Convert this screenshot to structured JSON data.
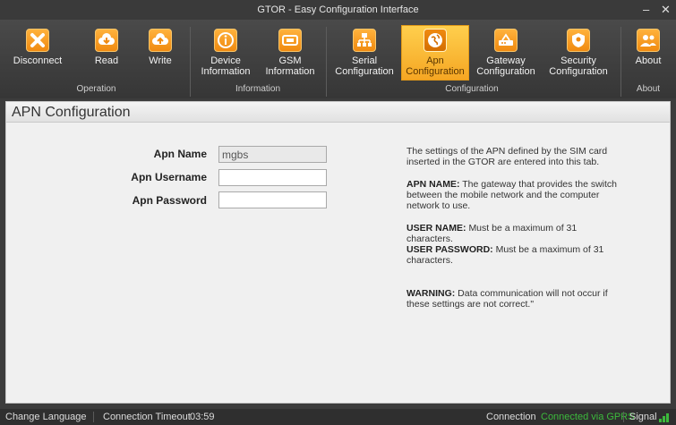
{
  "window": {
    "title": "GTOR - Easy Configuration Interface",
    "minimize": "–",
    "close": "✕"
  },
  "ribbon": {
    "buttons": [
      {
        "label": "Disconnect",
        "icon": "disconnect-icon"
      },
      {
        "label": "Read",
        "icon": "cloud-download-icon"
      },
      {
        "label": "Write",
        "icon": "cloud-upload-icon"
      },
      {
        "label": "Device\nInformation",
        "icon": "info-icon"
      },
      {
        "label": "GSM\nInformation",
        "icon": "sim-card-icon"
      },
      {
        "label": "Serial\nConfiguration",
        "icon": "network-tree-icon"
      },
      {
        "label": "Apn\nConfiguration",
        "icon": "globe-icon"
      },
      {
        "label": "Gateway\nConfiguration",
        "icon": "router-icon"
      },
      {
        "label": "Security\nConfiguration",
        "icon": "shield-icon"
      },
      {
        "label": "About",
        "icon": "users-icon"
      }
    ],
    "groups": [
      "Operation",
      "Information",
      "Configuration",
      "About"
    ],
    "active_color": "#f5a623"
  },
  "page": {
    "title": "APN Configuration"
  },
  "form": {
    "apn_name_label": "Apn Name",
    "apn_name_value": "mgbs",
    "apn_username_label": "Apn Username",
    "apn_username_value": "",
    "apn_password_label": "Apn Password",
    "apn_password_value": ""
  },
  "help": {
    "intro": "The settings of the APN defined by the SIM card inserted in the GTOR are entered into this tab.",
    "apn_name_title": "APN NAME:",
    "apn_name_text": "The gateway that provides the switch between the mobile network and the computer network to use.",
    "user_name_title": "USER NAME:",
    "user_name_text": "Must be a maximum of 31 characters.",
    "user_password_title": "USER PASSWORD:",
    "user_password_text": "Must be a maximum of 31 characters.",
    "warning_title": "WARNING:",
    "warning_text": "Data communication will not occur if these settings are not correct.\""
  },
  "status": {
    "change_language": "Change Language",
    "timeout_label": "Connection Timeout",
    "timeout_value": "03:59",
    "connection_label": "Connection",
    "connection_value": "Connected via GPRS",
    "connection_color": "#3cba3c",
    "signal_label": "Signal"
  }
}
